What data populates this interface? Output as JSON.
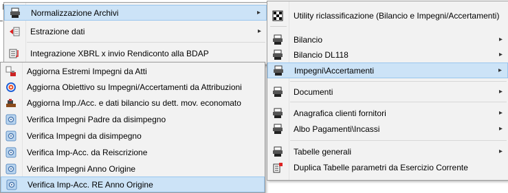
{
  "left_menu": {
    "items": [
      {
        "label": "Normalizzazione Archivi",
        "icon": "archive-press-icon",
        "has_submenu": true
      },
      {
        "label": "Estrazione dati",
        "icon": "data-export-icon",
        "has_submenu": true
      },
      {
        "label": "Integrazione XBRL x invio Rendiconto alla BDAP",
        "icon": "xbrl-document-icon",
        "has_submenu": false
      }
    ]
  },
  "sub_menu": {
    "items": [
      {
        "label": "Aggiorna Estremi Impegni da Atti",
        "icon": "update-acts-icon"
      },
      {
        "label": "Aggiorna Obiettivo su Impegni/Accertamenti da Attribuzioni",
        "icon": "target-icon"
      },
      {
        "label": "Aggiorna Imp./Acc. e dati bilancio su dett. mov. economato",
        "icon": "stapler-icon"
      },
      {
        "label": "Verifica Impegni  Padre da disimpegno",
        "icon": "verify-gear-icon"
      },
      {
        "label": "Verifica Impegni da disimpegno",
        "icon": "verify-gear-icon"
      },
      {
        "label": "Verifica Imp-Acc. da Reiscrizione",
        "icon": "verify-gear-icon"
      },
      {
        "label": "Verifica Impegni Anno Origine",
        "icon": "verify-gear-icon"
      },
      {
        "label": "Verifica Imp-Acc. RE Anno Origine",
        "icon": "verify-gear-icon"
      }
    ]
  },
  "right_menu": {
    "items": [
      {
        "label": "Utility riclassificazione (Bilancio e Impegni/Accertamenti)",
        "icon": "grid-icon"
      },
      {
        "label": "Bilancio",
        "icon": "archive-press-icon"
      },
      {
        "label": "Bilancio DL118",
        "icon": "archive-press-icon"
      },
      {
        "label": "Impegni\\Accertamenti",
        "icon": "archive-press-icon"
      },
      {
        "label": "Documenti",
        "icon": "archive-press-icon"
      },
      {
        "label": "Anagrafica clienti fornitori",
        "icon": "archive-press-icon"
      },
      {
        "label": "Albo Pagamenti\\Incassi",
        "icon": "archive-press-icon"
      },
      {
        "label": "Tabelle generali",
        "icon": "archive-press-icon"
      },
      {
        "label": "Duplica Tabelle parametri da Esercizio Corrente",
        "icon": "duplicate-table-icon"
      }
    ]
  },
  "colors": {
    "highlight": "#cce3f7",
    "highlight_border": "#99c6ee",
    "menu_bg": "#f2f2f2"
  }
}
